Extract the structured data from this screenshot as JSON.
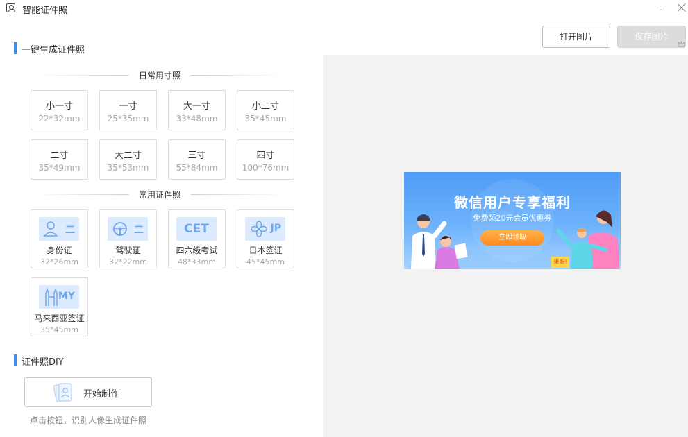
{
  "window": {
    "title": "智能证件照"
  },
  "toolbar": {
    "open_label": "打开图片",
    "save_label": "保存图片"
  },
  "section_one_click": {
    "title": "一键生成证件照"
  },
  "divider_daily": {
    "label": "日常用寸照"
  },
  "daily_sizes": [
    {
      "name": "小一寸",
      "size": "22*32mm"
    },
    {
      "name": "一寸",
      "size": "25*35mm"
    },
    {
      "name": "大一寸",
      "size": "33*48mm"
    },
    {
      "name": "小二寸",
      "size": "35*45mm"
    },
    {
      "name": "二寸",
      "size": "35*49mm"
    },
    {
      "name": "大二寸",
      "size": "35*53mm"
    },
    {
      "name": "三寸",
      "size": "55*84mm"
    },
    {
      "name": "四寸",
      "size": "100*76mm"
    }
  ],
  "divider_common": {
    "label": "常用证件照"
  },
  "documents": [
    {
      "name": "身份证",
      "size": "32*26mm",
      "icon": "id-card-icon",
      "icon_text": "二"
    },
    {
      "name": "驾驶证",
      "size": "32*22mm",
      "icon": "steering-wheel-icon",
      "icon_text": "二"
    },
    {
      "name": "四六级考试",
      "size": "48*33mm",
      "icon": "cet-icon",
      "icon_text": "CET"
    },
    {
      "name": "日本签证",
      "size": "45*45mm",
      "icon": "sakura-icon",
      "icon_text": "JP"
    },
    {
      "name": "马来西亚签证",
      "size": "35*45mm",
      "icon": "twin-towers-icon",
      "icon_text": "MY"
    }
  ],
  "section_diy": {
    "title": "证件照DIY"
  },
  "diy": {
    "start_label": "开始制作",
    "hint": "点击按钮，识别人像生成证件照"
  },
  "banner": {
    "title": "微信用户专享福利",
    "subtitle": "免费领20元会员优惠券",
    "button": "立即领取",
    "tag": "果断!"
  },
  "colors": {
    "accent": "#3c8cf0",
    "icon_bg": "#dbeafc",
    "icon_fg": "#6ea6ec"
  }
}
